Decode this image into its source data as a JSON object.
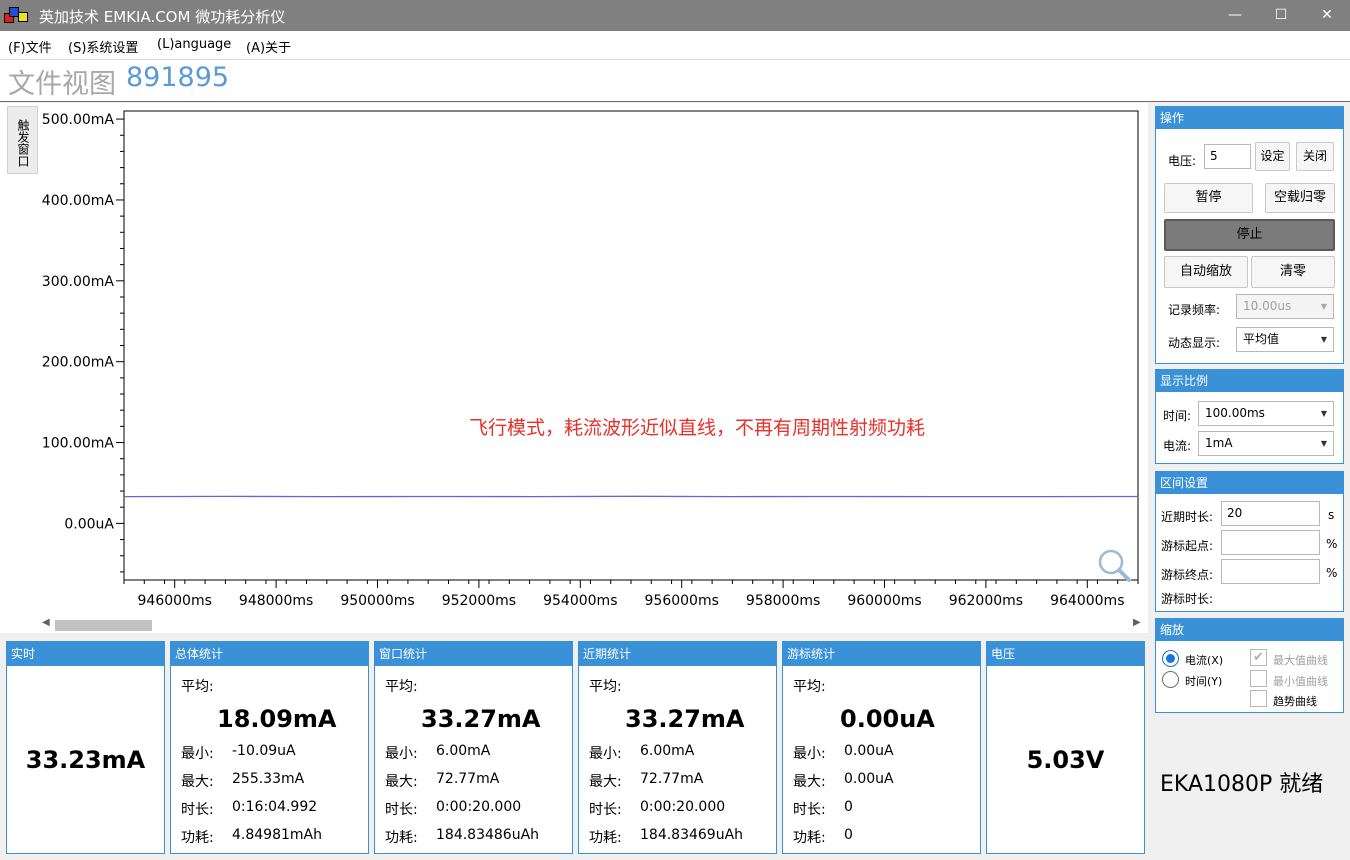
{
  "window": {
    "title": "英加技术 EMKIA.COM 微功耗分析仪",
    "minimize": "—",
    "maximize": "☐",
    "close": "✕"
  },
  "menu": [
    "(F)文件",
    "(S)系统设置",
    "(L)anguage",
    "(A)关于"
  ],
  "header": {
    "view_label": "文件视图",
    "view_id": "891895"
  },
  "trigger_button": "触发窗口",
  "chart_data": {
    "type": "line",
    "title": "",
    "xlabel": "",
    "ylabel": "",
    "x_ticks": [
      "946000ms",
      "948000ms",
      "950000ms",
      "952000ms",
      "954000ms",
      "956000ms",
      "958000ms",
      "960000ms",
      "962000ms",
      "964000ms"
    ],
    "y_ticks": [
      "500.00mA",
      "400.00mA",
      "300.00mA",
      "200.00mA",
      "100.00mA",
      "0.00uA"
    ],
    "y_tick_values": [
      500,
      400,
      300,
      200,
      100,
      0
    ],
    "xlim": [
      945000,
      965000
    ],
    "ylim": [
      -70,
      510
    ],
    "series": [
      {
        "color": "#6666cc",
        "x": [
          945000,
          947000,
          949000,
          951000,
          953000,
          955000,
          957000,
          959000,
          961000,
          963000,
          965000
        ],
        "y": [
          33.2,
          33.4,
          33.1,
          33.3,
          33.2,
          33.5,
          33.2,
          33.3,
          33.1,
          33.2,
          33.3
        ]
      }
    ],
    "annotation": "飞行模式，耗流波形近似直线，不再有周期性射频功耗",
    "annotation_color": "#e8302a",
    "grid": false
  },
  "controls": {
    "ops_title": "操作",
    "voltage_label": "电压:",
    "voltage_value": "5",
    "set_btn": "设定",
    "close_btn": "关闭",
    "pause_btn": "暂停",
    "zero_btn": "空载归零",
    "stop_btn": "停止",
    "autoscale_btn": "自动缩放",
    "clear_btn": "清零",
    "rate_label": "记录频率:",
    "rate_value": "10.00us",
    "display_label": "动态显示:",
    "display_value": "平均值"
  },
  "scale": {
    "title": "显示比例",
    "time_label": "时间:",
    "time_value": "100.00ms",
    "current_label": "电流:",
    "current_value": "1mA"
  },
  "range": {
    "title": "区间设置",
    "recent_label": "近期时长:",
    "recent_value": "20",
    "recent_unit": "s",
    "start_label": "游标起点:",
    "start_unit": "%",
    "end_label": "游标终点:",
    "end_unit": "%",
    "cursor_len_label": "游标时长:"
  },
  "zoom": {
    "title": "缩放",
    "radio_current": "电流(X)",
    "radio_time": "时间(Y)",
    "cb_max": "最大值曲线",
    "cb_min": "最小值曲线",
    "cb_trend": "趋势曲线"
  },
  "status": "EKA1080P  就绪",
  "stats": {
    "realtime": {
      "title": "实时",
      "value": "33.23mA"
    },
    "voltage": {
      "title": "电压",
      "value": "5.03V"
    },
    "total": {
      "title": "总体统计",
      "avg_label": "平均:",
      "avg": "18.09mA",
      "min_label": "最小:",
      "min": "-10.09uA",
      "max_label": "最大:",
      "max": "255.33mA",
      "dur_label": "时长:",
      "dur": "0:16:04.992",
      "pow_label": "功耗:",
      "pow": "4.84981mAh"
    },
    "window": {
      "title": "窗口统计",
      "avg_label": "平均:",
      "avg": "33.27mA",
      "min_label": "最小:",
      "min": "6.00mA",
      "max_label": "最大:",
      "max": "72.77mA",
      "dur_label": "时长:",
      "dur": "0:00:20.000",
      "pow_label": "功耗:",
      "pow": "184.83486uAh"
    },
    "recent": {
      "title": "近期统计",
      "avg_label": "平均:",
      "avg": "33.27mA",
      "min_label": "最小:",
      "min": "6.00mA",
      "max_label": "最大:",
      "max": "72.77mA",
      "dur_label": "时长:",
      "dur": "0:00:20.000",
      "pow_label": "功耗:",
      "pow": "184.83469uAh"
    },
    "cursor": {
      "title": "游标统计",
      "avg_label": "平均:",
      "avg": "0.00uA",
      "min_label": "最小:",
      "min": "0.00uA",
      "max_label": "最大:",
      "max": "0.00uA",
      "dur_label": "时长:",
      "dur": "0",
      "pow_label": "功耗:",
      "pow": "0"
    }
  }
}
